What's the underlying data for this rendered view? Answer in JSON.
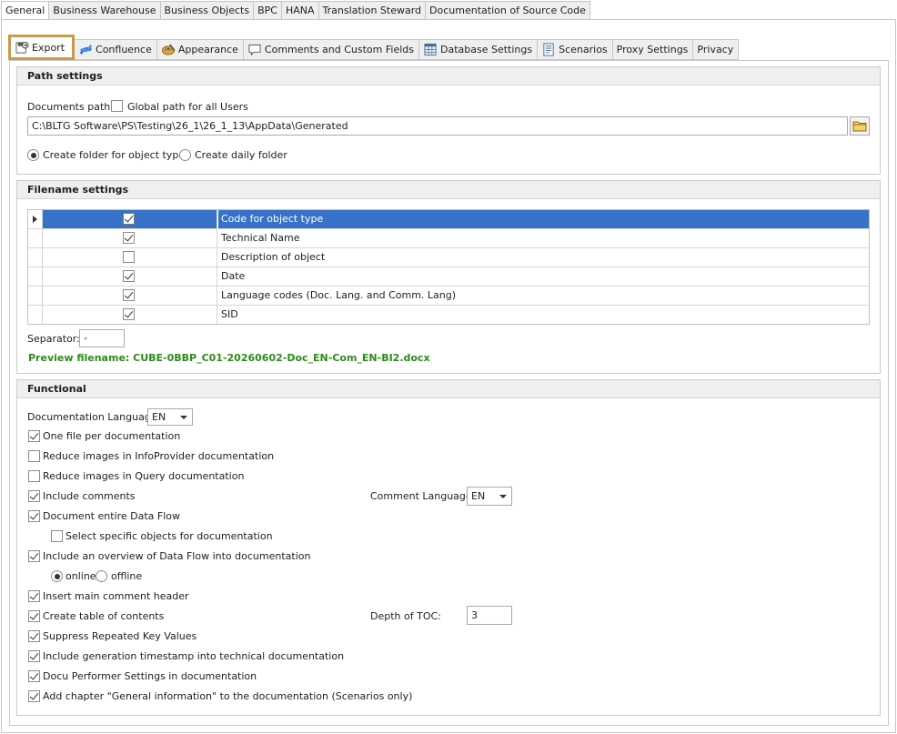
{
  "top_tabs": [
    {
      "label": "General",
      "active": true
    },
    {
      "label": "Business Warehouse"
    },
    {
      "label": "Business Objects"
    },
    {
      "label": "BPC"
    },
    {
      "label": "HANA"
    },
    {
      "label": "Translation Steward"
    },
    {
      "label": "Documentation of Source Code"
    }
  ],
  "sub_tabs": [
    {
      "label": "Export",
      "icon": "export-icon",
      "active": true
    },
    {
      "label": "Confluence",
      "icon": "confluence-icon"
    },
    {
      "label": "Appearance",
      "icon": "palette-icon"
    },
    {
      "label": "Comments and Custom Fields",
      "icon": "comment-icon"
    },
    {
      "label": "Database Settings",
      "icon": "database-icon"
    },
    {
      "label": "Scenarios",
      "icon": "document-icon"
    },
    {
      "label": "Proxy Settings",
      "icon": ""
    },
    {
      "label": "Privacy",
      "icon": ""
    }
  ],
  "path_settings": {
    "title": "Path settings",
    "documents_path_label": "Documents path:",
    "global_path_label": "Global path for all Users",
    "global_path_checked": false,
    "path_value": "C:\\BLTG Software\\PS\\Testing\\26_1\\26_1_13\\AppData\\Generated",
    "radio_create_folder": "Create folder for object type",
    "radio_daily_folder": "Create daily folder",
    "selected_radio": "create_folder"
  },
  "filename_settings": {
    "title": "Filename settings",
    "rows": [
      {
        "checked": true,
        "label": "Code for object type",
        "selected": true
      },
      {
        "checked": true,
        "label": "Technical Name"
      },
      {
        "checked": false,
        "label": "Description of object"
      },
      {
        "checked": true,
        "label": "Date"
      },
      {
        "checked": true,
        "label": "Language codes (Doc. Lang. and Comm. Lang)"
      },
      {
        "checked": true,
        "label": "SID"
      }
    ],
    "separator_label": "Separator:",
    "separator_value": "-",
    "preview_label": "Preview filename: CUBE-0BBP_C01-20260602-Doc_EN-Com_EN-BI2.docx"
  },
  "functional": {
    "title": "Functional",
    "doc_language_label": "Documentation Language",
    "doc_language_value": "EN",
    "one_file": "One file per documentation",
    "reduce_infoprovider": "Reduce images in InfoProvider documentation",
    "reduce_query": "Reduce images in Query documentation",
    "include_comments": "Include comments",
    "comment_language_label": "Comment Language",
    "comment_language_value": "EN",
    "document_dataflow": "Document entire Data Flow",
    "select_specific": "Select specific objects for documentation",
    "include_overview": "Include an overview of Data Flow into documentation",
    "online": "online",
    "offline": "offline",
    "insert_header": "Insert main comment header",
    "create_toc": "Create table of contents",
    "depth_toc_label": "Depth of TOC:",
    "depth_toc_value": "3",
    "suppress_repeated": "Suppress Repeated Key Values",
    "include_timestamp": "Include generation timestamp into technical documentation",
    "docu_performer": "Docu Performer Settings in documentation",
    "add_chapter": "Add chapter \"General information\" to the documentation (Scenarios only)"
  }
}
